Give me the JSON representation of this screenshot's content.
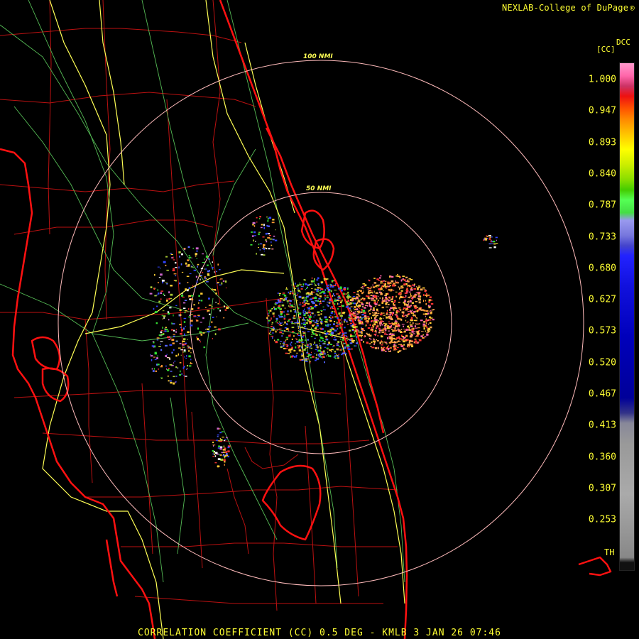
{
  "credit": {
    "text": "NEXLAB-College of DuPage",
    "mark": "®"
  },
  "legend": {
    "title_top": "DCC",
    "title_units": "[CC]",
    "ticks": [
      "1.000",
      "0.947",
      "0.893",
      "0.840",
      "0.787",
      "0.733",
      "0.680",
      "0.627",
      "0.573",
      "0.520",
      "0.467",
      "0.413",
      "0.360",
      "0.307",
      "0.253"
    ],
    "th_label": "TH",
    "colors": [
      "#ff99cc",
      "#ff66aa",
      "#cc3366",
      "#ee1111",
      "#ff5500",
      "#ff8800",
      "#ffbb00",
      "#ffff00",
      "#ccee00",
      "#88dd00",
      "#44cc00",
      "#55ff55",
      "#44dd44",
      "#9999ee",
      "#7777dd",
      "#4444cc",
      "#2222ff",
      "#1111dd",
      "#0000bb",
      "#000099",
      "#333388",
      "#888899",
      "#999999",
      "#aaaaaa",
      "#111111"
    ]
  },
  "rings": {
    "outer_label": "100 NMI",
    "inner_label": "50 NMI"
  },
  "caption": "CORRELATION COEFFICIENT (CC) 0.5 DEG - KMLB 3 JAN 26 07:46",
  "map_colors": {
    "coast": "#ff1111",
    "county": "#cc1111",
    "highway": "#ffff55",
    "road": "#66cc66",
    "ring": "#ffbbbb",
    "echo_hi": "#ff9933",
    "echo_mid": "#3344ff",
    "echo_lo": "#aacc33"
  }
}
